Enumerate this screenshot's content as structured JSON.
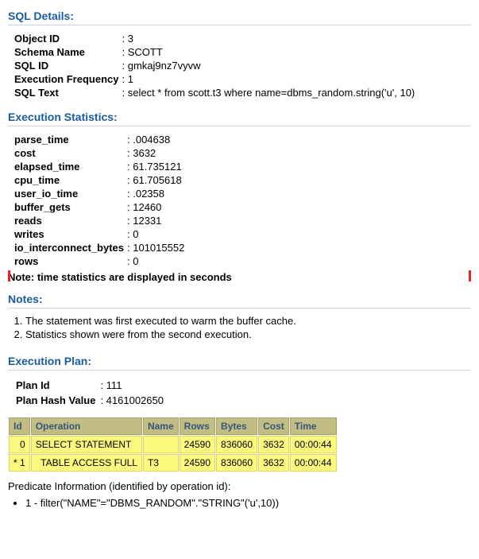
{
  "sql_details": {
    "header": "SQL Details:",
    "rows": [
      {
        "k": "Object ID",
        "v": "3"
      },
      {
        "k": "Schema Name",
        "v": "SCOTT"
      },
      {
        "k": "SQL ID",
        "v": "gmkaj9nz7vyvw"
      },
      {
        "k": "Execution Frequency",
        "v": "1"
      },
      {
        "k": "SQL Text",
        "v": "select * from scott.t3 where name=dbms_random.string('u', 10)"
      }
    ]
  },
  "exec_stats": {
    "header": "Execution Statistics:",
    "rows": [
      {
        "k": "parse_time",
        "v": ".004638"
      },
      {
        "k": "cost",
        "v": "3632"
      },
      {
        "k": "elapsed_time",
        "v": "61.735121"
      },
      {
        "k": "cpu_time",
        "v": "61.705618"
      },
      {
        "k": "user_io_time",
        "v": ".02358"
      },
      {
        "k": "buffer_gets",
        "v": "12460"
      },
      {
        "k": "reads",
        "v": "12331"
      },
      {
        "k": "writes",
        "v": "0"
      },
      {
        "k": "io_interconnect_bytes",
        "v": "101015552"
      },
      {
        "k": "rows",
        "v": "0"
      }
    ],
    "note": "Note: time statistics are displayed in seconds"
  },
  "notes": {
    "header": "Notes:",
    "items": [
      "The statement was first executed to warm the buffer cache.",
      "Statistics shown were from the second execution."
    ]
  },
  "exec_plan": {
    "header": "Execution Plan:",
    "kv": [
      {
        "k": "Plan Id",
        "v": "111"
      },
      {
        "k": "Plan Hash Value",
        "v": "4161002650"
      }
    ],
    "columns": [
      "Id",
      "Operation",
      "Name",
      "Rows",
      "Bytes",
      "Cost",
      "Time"
    ],
    "rows": [
      {
        "id": "0",
        "op": "SELECT STATEMENT",
        "name": "",
        "rows": "24590",
        "bytes": "836060",
        "cost": "3632",
        "time": "00:00:44"
      },
      {
        "id": "* 1",
        "op": "  TABLE ACCESS FULL",
        "name": "T3",
        "rows": "24590",
        "bytes": "836060",
        "cost": "3632",
        "time": "00:00:44"
      }
    ],
    "pred_label": "Predicate Information (identified by operation id):",
    "pred_items": [
      "1 - filter(\"NAME\"=\"DBMS_RANDOM\".\"STRING\"('u',10))"
    ]
  },
  "chart_data": {
    "type": "table",
    "title": "Execution Plan",
    "columns": [
      "Id",
      "Operation",
      "Name",
      "Rows",
      "Bytes",
      "Cost",
      "Time"
    ],
    "rows": [
      [
        "0",
        "SELECT STATEMENT",
        "",
        24590,
        836060,
        3632,
        "00:00:44"
      ],
      [
        "* 1",
        "TABLE ACCESS FULL",
        "T3",
        24590,
        836060,
        3632,
        "00:00:44"
      ]
    ]
  }
}
